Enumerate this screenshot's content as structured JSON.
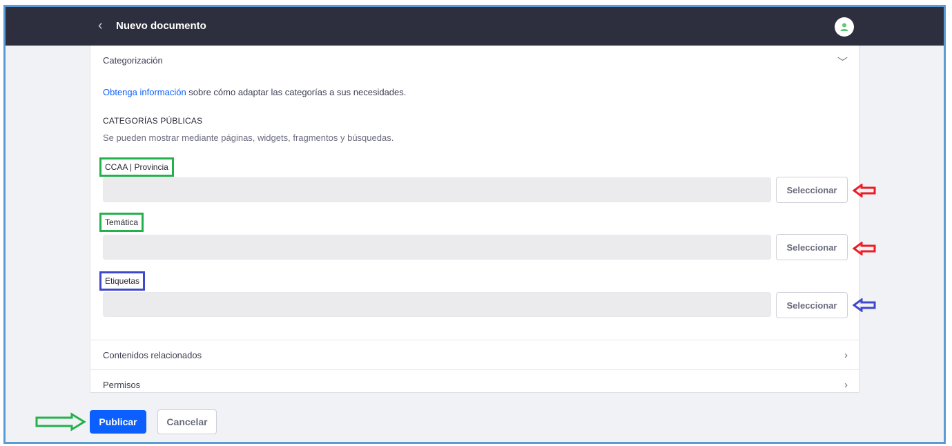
{
  "header": {
    "back_icon": "‹",
    "title": "Nuevo documento"
  },
  "categorization": {
    "label": "Categorización",
    "chevron": "﹀",
    "info_link": "Obtenga información",
    "info_rest": " sobre cómo adaptar las categorías a sus necesidades.",
    "public_heading": "CATEGORÍAS PÚBLICAS",
    "public_desc": "Se pueden mostrar mediante páginas, widgets, fragmentos y búsquedas.",
    "fields": [
      {
        "label": "CCAA | Provincia",
        "value": "",
        "button": "Seleccionar",
        "highlight": "#22b14c",
        "arrow": "#ed1c24"
      },
      {
        "label": "Temática",
        "value": "",
        "button": "Seleccionar",
        "highlight": "#22b14c",
        "arrow": "#ed1c24"
      },
      {
        "label": "Etiquetas",
        "value": "",
        "button": "Seleccionar",
        "highlight": "#3f48cc",
        "arrow": "#3f48cc"
      }
    ]
  },
  "sections": [
    {
      "label": "Contenidos relacionados",
      "chevron": "›"
    },
    {
      "label": "Permisos",
      "chevron": "›"
    }
  ],
  "footer": {
    "publish": "Publicar",
    "cancel": "Cancelar",
    "arrow_color": "#22b14c"
  },
  "colors": {
    "topbar": "#2e2f3e",
    "primary": "#0b5fff",
    "frame_border": "#5b9bd5"
  }
}
